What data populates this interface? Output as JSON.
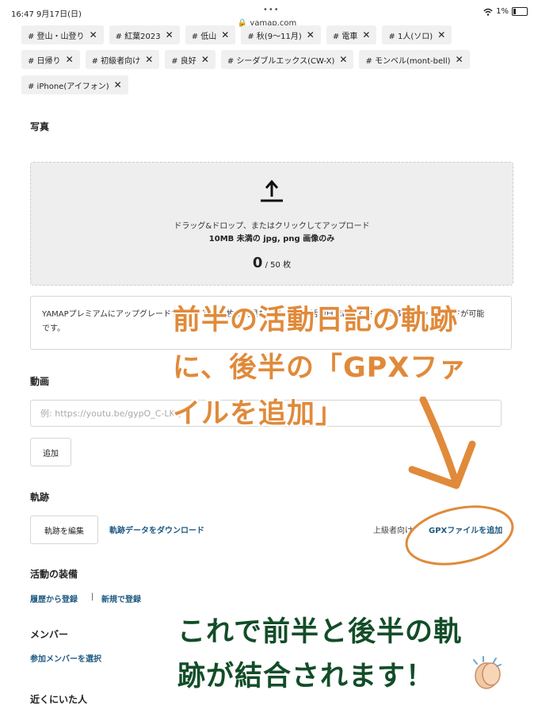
{
  "status": {
    "time": "16:47",
    "date": "9月17日(日)",
    "url": "yamap.com",
    "battery": "1%"
  },
  "tags_row1": [
    "# 登山・山登り",
    "# 紅葉2023",
    "# 低山",
    "# 秋(9〜11月)",
    "# 電車",
    "# 1人(ソロ)"
  ],
  "tags_row2": [
    "# 日帰り",
    "# 初級者向け",
    "# 良好",
    "# シーダブルエックス(CW-X)",
    "# モンベル(mont-bell)"
  ],
  "tags_row3": [
    "# iPhone(アイフォン)"
  ],
  "photo": {
    "heading": "写真",
    "drop_text": "ドラッグ&ドロップ、またはクリックしてアップロード",
    "limit_text": "10MB 未満の jpg, png 画像のみ",
    "count": "0",
    "count_suffix": "/ 50 枚"
  },
  "premium": {
    "text": "YAMAPプレミアムにアップグレードすると、写真の枚数制限なしで、1つの活動日記にたくさんの写真のアップロードが可能です。"
  },
  "video": {
    "heading": "動画",
    "placeholder": "例: https://youtu.be/gypO_C-LKQ",
    "add_label": "追加"
  },
  "track": {
    "heading": "軌跡",
    "edit_label": "軌跡を編集",
    "download_label": "軌跡データをダウンロード",
    "advanced_label": "上級者向け",
    "gpx_label": "GPXファイルを追加"
  },
  "gear": {
    "heading": "活動の装備",
    "history_label": "履歴から登録",
    "separator": "|",
    "new_label": "新規で登録"
  },
  "members": {
    "heading": "メンバー",
    "select_label": "参加メンバーを選択"
  },
  "nearby": {
    "heading": "近くにいた人"
  },
  "overlay": {
    "orange_line1": "前半の活動日記の軌跡",
    "orange_line2": "に、後半の「GPXファ",
    "orange_line3": "イルを追加」",
    "green_line1": "これで前半と後半の軌",
    "green_line2": "跡が結合されます！"
  },
  "colors": {
    "accent_orange": "#e08a3a",
    "accent_green": "#124d28",
    "link": "#1f5a82"
  },
  "icons": [
    "upload-icon",
    "remove-tag-icon",
    "wifi-icon",
    "battery-icon",
    "clapping-hands-icon"
  ]
}
